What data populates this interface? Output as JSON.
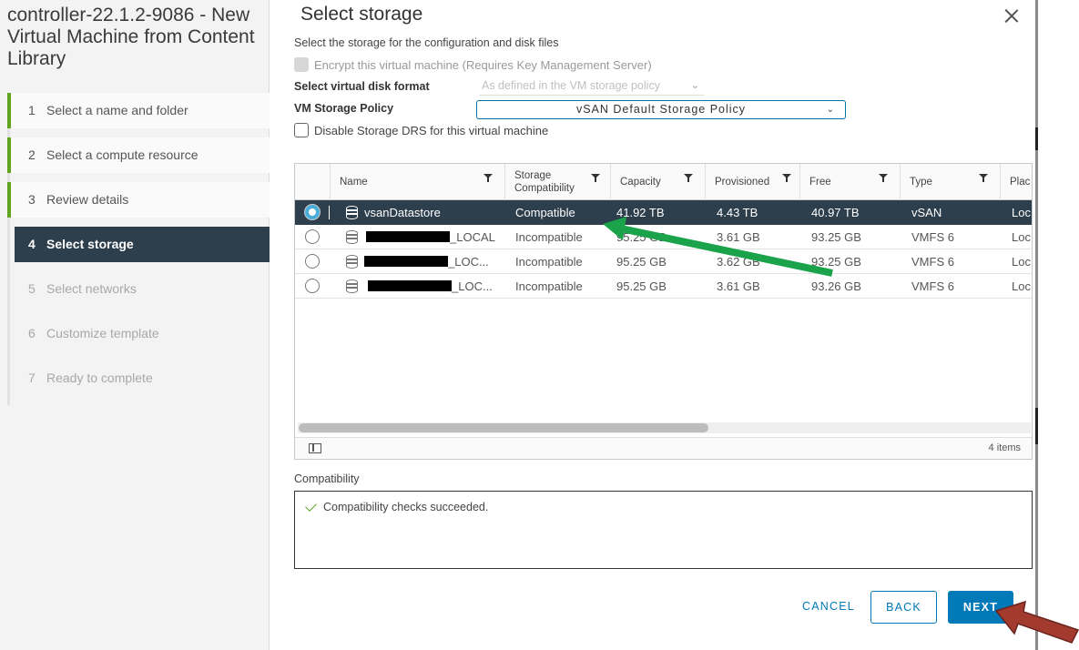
{
  "wizard": {
    "title": "controller-22.1.2-9086 - New Virtual Machine from Content Library",
    "steps": [
      {
        "num": "1",
        "label": "Select a name and folder"
      },
      {
        "num": "2",
        "label": "Select a compute resource"
      },
      {
        "num": "3",
        "label": "Review details"
      },
      {
        "num": "4",
        "label": "Select storage"
      },
      {
        "num": "5",
        "label": "Select networks"
      },
      {
        "num": "6",
        "label": "Customize template"
      },
      {
        "num": "7",
        "label": "Ready to complete"
      }
    ]
  },
  "dialog": {
    "title": "Select storage",
    "subtitle": "Select the storage for the configuration and disk files",
    "encrypt_label": "Encrypt this virtual machine (Requires Key Management Server)",
    "disk_format_label": "Select virtual disk format",
    "disk_format_value": "As defined in the VM storage policy",
    "policy_label": "VM Storage Policy",
    "policy_value": "vSAN Default Storage Policy",
    "drs_label": "Disable Storage DRS for this virtual machine"
  },
  "grid": {
    "columns": [
      "Name",
      "Storage Compatibility",
      "Capacity",
      "Provisioned",
      "Free",
      "Type",
      "Plac"
    ],
    "rows": [
      {
        "name": "vsanDatastore",
        "compat": "Compatible",
        "capacity": "41.92 TB",
        "provisioned": "4.43 TB",
        "free": "40.97 TB",
        "type": "vSAN",
        "place": "Loc",
        "selected": true
      },
      {
        "name": "_LOCAL",
        "compat": "Incompatible",
        "capacity": "95.25 GB",
        "provisioned": "3.61 GB",
        "free": "93.25 GB",
        "type": "VMFS 6",
        "place": "Loc",
        "selected": false
      },
      {
        "name": "_LOC...",
        "compat": "Incompatible",
        "capacity": "95.25 GB",
        "provisioned": "3.62 GB",
        "free": "93.25 GB",
        "type": "VMFS 6",
        "place": "Loc",
        "selected": false
      },
      {
        "name": "_LOC...",
        "compat": "Incompatible",
        "capacity": "95.25 GB",
        "provisioned": "3.61 GB",
        "free": "93.26 GB",
        "type": "VMFS 6",
        "place": "Loc",
        "selected": false
      }
    ],
    "items_count": "4 items"
  },
  "compatibility": {
    "label": "Compatibility",
    "message": "Compatibility checks succeeded."
  },
  "buttons": {
    "cancel": "CANCEL",
    "back": "BACK",
    "next": "NEXT"
  },
  "colors": {
    "accent": "#0079b8",
    "selected_row": "#2d3e4c",
    "annotation_green": "#1aa34a",
    "annotation_red": "#a33a2e"
  }
}
